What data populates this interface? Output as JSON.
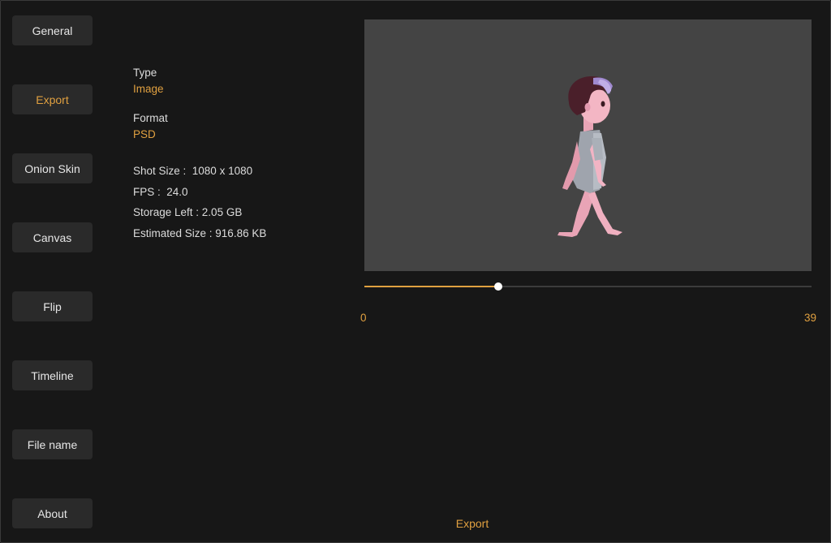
{
  "sidebar": {
    "items": [
      {
        "label": "General"
      },
      {
        "label": "Export",
        "active": true
      },
      {
        "label": "Onion Skin"
      },
      {
        "label": "Canvas"
      },
      {
        "label": "Flip"
      },
      {
        "label": "Timeline"
      },
      {
        "label": "File name"
      },
      {
        "label": "About"
      }
    ]
  },
  "settings": {
    "type_label": "Type",
    "type_value": "Image",
    "format_label": "Format",
    "format_value": "PSD",
    "shot_size": "Shot Size :  1080 x 1080",
    "fps": "FPS :  24.0",
    "storage_left": "Storage Left : 2.05 GB",
    "estimated_size": "Estimated Size : 916.86 KB"
  },
  "timeline": {
    "min_label": "0",
    "max_label": "39",
    "current_fraction": 0.3
  },
  "export_button": "Export",
  "colors": {
    "accent": "#e0a040",
    "background": "#171717",
    "button": "#2a2a2a",
    "preview_bg": "#444444"
  }
}
